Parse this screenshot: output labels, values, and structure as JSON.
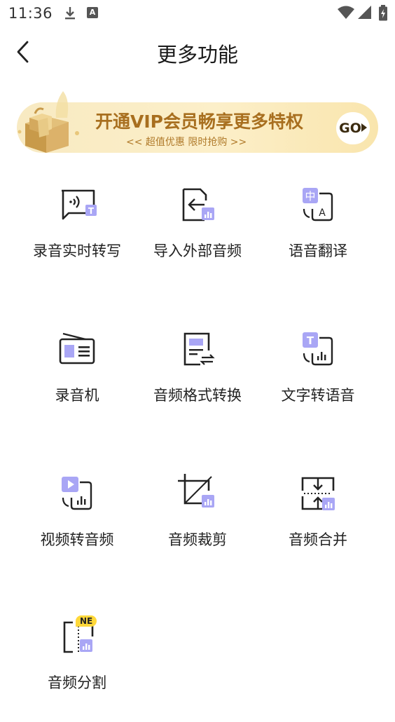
{
  "status_bar": {
    "time": "11:36"
  },
  "header": {
    "title": "更多功能"
  },
  "banner": {
    "title": "开通VIP会员畅享更多特权",
    "subtitle": "<< 超值优惠  限时抢购 >>",
    "go_label": "GO"
  },
  "features": [
    {
      "label": "录音实时转写"
    },
    {
      "label": "导入外部音频"
    },
    {
      "label": "语音翻译"
    },
    {
      "label": "录音机"
    },
    {
      "label": "音频格式转换"
    },
    {
      "label": "文字转语音"
    },
    {
      "label": "视频转音频"
    },
    {
      "label": "音频裁剪"
    },
    {
      "label": "音频合并"
    },
    {
      "label": "音频分割",
      "badge": "NE"
    }
  ],
  "icons": {
    "translate_cn": "中",
    "translate_en": "A",
    "text_t": "T"
  },
  "colors": {
    "accent": "#a9a6f5",
    "icon_stroke": "#222222",
    "banner_text": "#a86f1f",
    "badge": "#ffd83a"
  }
}
